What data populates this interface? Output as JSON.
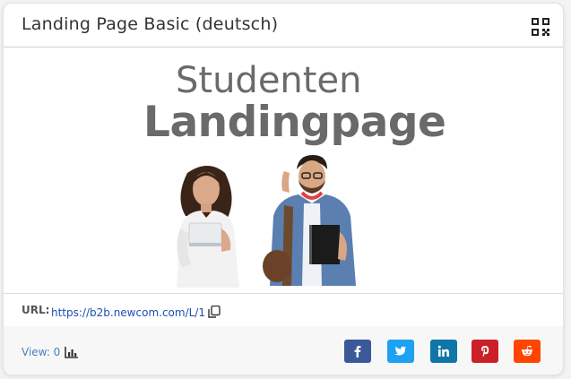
{
  "card": {
    "title": "Landing Page Basic (deutsch)"
  },
  "hero": {
    "line1": "Studenten",
    "line2": "Landingpage"
  },
  "url": {
    "label": "URL:",
    "link": "https://b2b.newcom.com/L/1"
  },
  "footer": {
    "views": "View: 0"
  },
  "icons": {
    "qr": "qr-code-icon",
    "copy": "copy-icon",
    "views": "chart-icon",
    "facebook": "facebook-icon",
    "twitter": "twitter-icon",
    "linkedin": "linkedin-icon",
    "pinterest": "pinterest-icon",
    "reddit": "reddit-icon"
  },
  "colors": {
    "facebook": "#3b5998",
    "twitter": "#1da1f2",
    "linkedin": "#0e76a8",
    "pinterest": "#cb2027",
    "reddit": "#ff4500",
    "hero_text": "#6a6a6a",
    "link": "#1a4fb3"
  }
}
